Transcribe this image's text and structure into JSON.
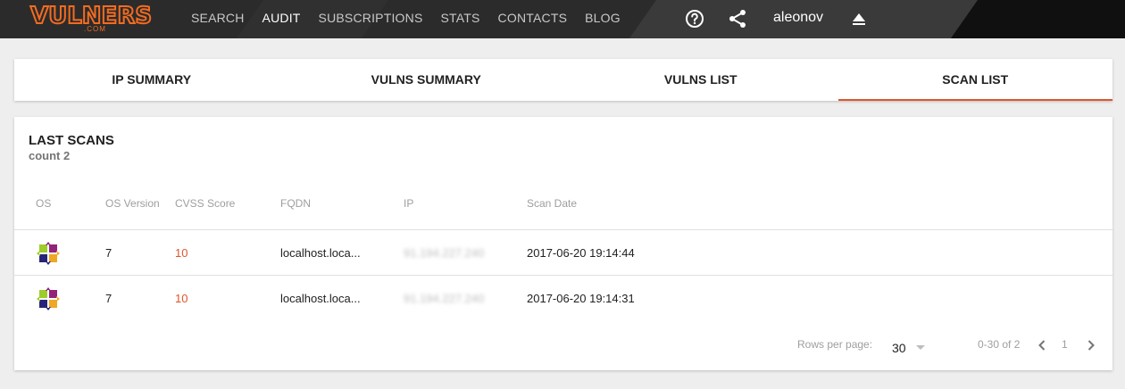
{
  "header": {
    "logo_text": "VULNERS",
    "logo_sub": ".COM",
    "nav": [
      "SEARCH",
      "AUDIT",
      "SUBSCRIPTIONS",
      "STATS",
      "CONTACTS",
      "BLOG"
    ],
    "username": "aleonov",
    "accent": "#f26b21"
  },
  "tabs": [
    "IP SUMMARY",
    "VULNS SUMMARY",
    "VULNS LIST",
    "SCAN LIST"
  ],
  "active_tab": "SCAN LIST",
  "scans": {
    "title": "LAST SCANS",
    "count": "count 2",
    "columns": [
      "OS",
      "OS Version",
      "CVSS Score",
      "FQDN",
      "IP",
      "Scan Date"
    ],
    "rows": [
      {
        "os_icon": "centos-icon",
        "os_version": "7",
        "cvss": "10",
        "fqdn": "localhost.loca...",
        "ip": "91.194.227.240",
        "date": "2017-06-20 19:14:44"
      },
      {
        "os_icon": "centos-icon",
        "os_version": "7",
        "cvss": "10",
        "fqdn": "localhost.loca...",
        "ip": "91.194.227.240",
        "date": "2017-06-20 19:14:31"
      }
    ],
    "pagination": {
      "rows_per_page_label": "Rows per page:",
      "rows_per_page": "30",
      "range": "0-30 of 2",
      "page": "1"
    }
  }
}
